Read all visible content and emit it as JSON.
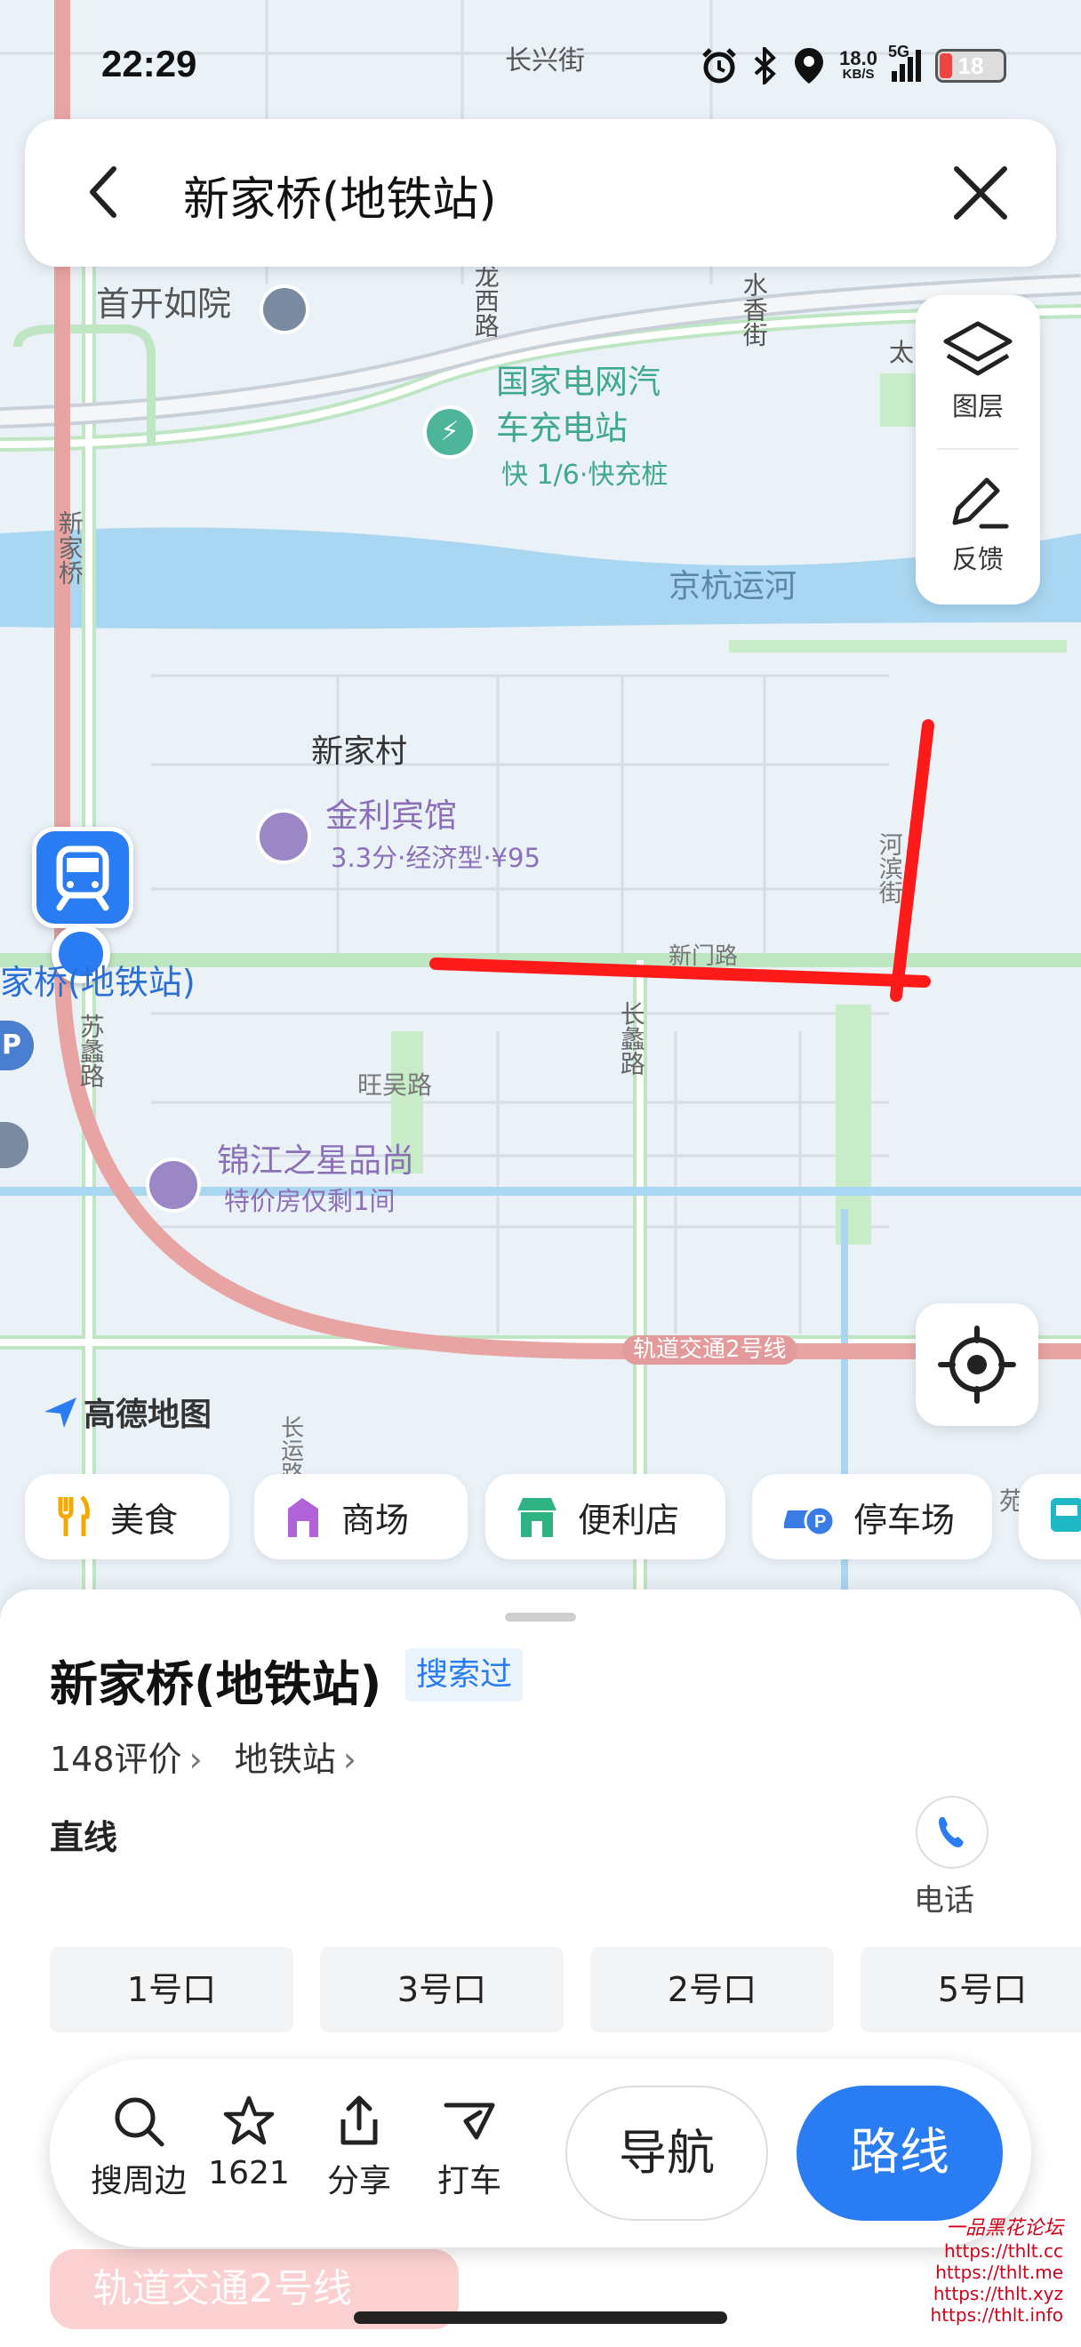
{
  "status_bar": {
    "time": "22:29",
    "speed_value": "18.0",
    "speed_unit": "KB/S",
    "network": "5G",
    "battery": "18",
    "icons": [
      "alarm-icon",
      "bluetooth-icon",
      "location-icon",
      "signal-icon",
      "battery-icon"
    ]
  },
  "search": {
    "query": "新家桥(地铁站)"
  },
  "map_tools": {
    "layers_label": "图层",
    "feedback_label": "反馈"
  },
  "map": {
    "labels": {
      "changxing_st": "长兴街",
      "shoukai_ruyuan": "首开如院",
      "longxi_rd": "龙西路",
      "shuixiang_st": "水香街",
      "tai": "太",
      "charging_station_line1": "国家电网汽",
      "charging_station_line2": "车充电站",
      "charging_info": "快 1/6·快充桩",
      "xinjia_rd": "新家桥",
      "jinghang_canal": "京杭运河",
      "xinjia_village": "新家村",
      "jinli_hotel": "金利宾馆",
      "jinli_hotel_info": "3.3分·经济型·¥95",
      "hebin_st": "河滨街",
      "xinmen_rd": "新门路",
      "changli_rd": "长蠡路",
      "sulie_rd": "苏蠡路",
      "wangwu_rd": "旺吴路",
      "jinjiang_star": "锦江之星品尚",
      "jinjiang_star_info": "特价房仅剩1间",
      "metro_line2": "轨道交通2号线",
      "changyun_rd": "长运路",
      "station_label": "家桥(地铁站)",
      "parking_p": "P",
      "yuan": "苑"
    },
    "brand": "高德地图"
  },
  "categories": [
    {
      "label": "美食",
      "icon": "food-icon"
    },
    {
      "label": "商场",
      "icon": "mall-icon"
    },
    {
      "label": "便利店",
      "icon": "store-icon"
    },
    {
      "label": "停车场",
      "icon": "parking-icon"
    }
  ],
  "place": {
    "name": "新家桥(地铁站)",
    "searched_tag": "搜索过",
    "reviews": "148评价",
    "category": "地铁站",
    "distance_label": "直线",
    "phone_label": "电话",
    "exits": [
      "1号口",
      "3号口",
      "2号口",
      "5号口"
    ]
  },
  "actions": {
    "nearby": "搜周边",
    "favorites": "1621",
    "share": "分享",
    "taxi": "打车",
    "navigate": "导航",
    "route": "路线"
  },
  "ghost_text": "轨道交通2号线",
  "watermark": {
    "title": "一品黑花论坛",
    "urls": [
      "https://thlt.cc",
      "https://thlt.me",
      "https://thlt.xyz",
      "https://thlt.info"
    ]
  },
  "colors": {
    "accent": "#2a7cf2",
    "annotation_red": "#ff1a1a",
    "metro_line": "#e8a3a3",
    "canal": "#a9d6f0"
  }
}
